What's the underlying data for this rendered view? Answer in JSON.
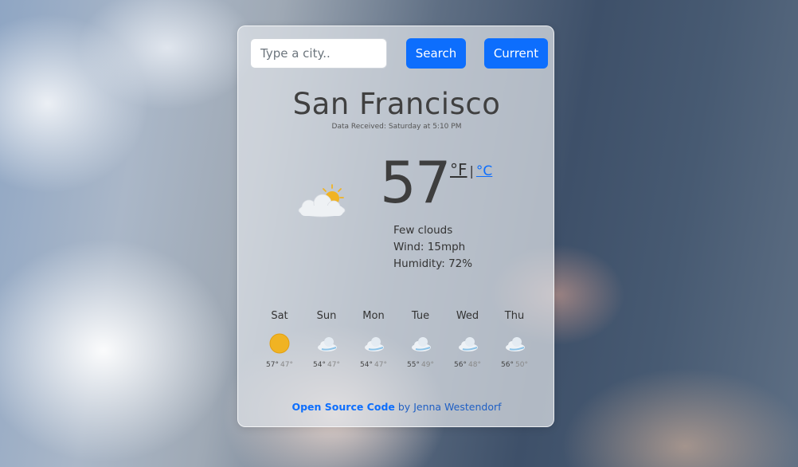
{
  "search": {
    "placeholder": "Type a city.."
  },
  "buttons": {
    "search": "Search",
    "current": "Current"
  },
  "weather": {
    "city": "San Francisco",
    "received_label": "Data Received:",
    "received_time": "Saturday at 5:10 PM",
    "temperature": "57",
    "unit_f": "°F",
    "unit_sep": "|",
    "unit_c": "°C",
    "description": "Few clouds",
    "wind": "Wind: 15mph",
    "humidity": "Humidity: 72%",
    "icon": "few-clouds-day-icon"
  },
  "forecast": [
    {
      "day": "Sat",
      "high": "57°",
      "low": "47°",
      "icon": "sun-icon"
    },
    {
      "day": "Sun",
      "high": "54°",
      "low": "47°",
      "icon": "cloud-icon"
    },
    {
      "day": "Mon",
      "high": "54°",
      "low": "47°",
      "icon": "cloud-icon"
    },
    {
      "day": "Tue",
      "high": "55°",
      "low": "49°",
      "icon": "cloud-icon"
    },
    {
      "day": "Wed",
      "high": "56°",
      "low": "48°",
      "icon": "cloud-icon"
    },
    {
      "day": "Thu",
      "high": "56°",
      "low": "50°",
      "icon": "cloud-icon"
    }
  ],
  "credit": {
    "link": "Open Source Code",
    "by": "by",
    "author": "Jenna Westendorf"
  },
  "colors": {
    "accent": "#0d6efd",
    "sun": "#f0b323",
    "text": "#404040"
  }
}
